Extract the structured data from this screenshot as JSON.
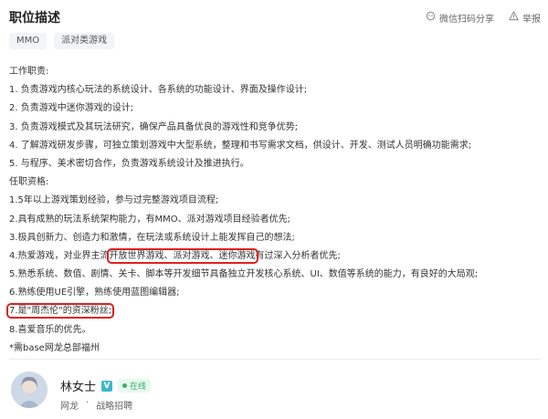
{
  "header": {
    "title": "职位描述",
    "share_label": "微信扫码分享",
    "report_label": "举报"
  },
  "tags": [
    "MMO",
    "派对类游戏"
  ],
  "description": {
    "lines": [
      "工作职责:",
      "1. 负责游戏内核心玩法的系统设计、各系统的功能设计、界面及操作设计;",
      "2. 负责游戏中迷你游戏的设计;",
      "3. 负责游戏模式及其玩法研究，确保产品具备优良的游戏性和竞争优势;",
      "4. 了解游戏研发步骤，可独立策划游戏中大型系统，整理和书写需求文档，供设计、开发、测试人员明确功能需求;",
      "5. 与程序、美术密切合作，负责游戏系统设计及推进执行。",
      "任职资格:",
      "1.5年以上游戏策划经验，参与过完整游戏项目流程;",
      "2.具有成熟的玩法系统架构能力，有MMO、派对游戏项目经验者优先;",
      "3.极具创新力、创造力和激情，在玩法或系统设计上能发挥自己的想法;"
    ],
    "line4_pre": "4.热爱游戏，对业界主流",
    "line4_highlight": "开放世界游戏、派对游戏、迷你游戏",
    "line4_post": "有过深入分析者优先;",
    "lines_b": [
      "5.熟悉系统、数值、剧情、关卡、脚本等开发细节具备独立开发核心系统、UI、数值等系统的能力，有良好的大局观;",
      "6.熟练使用UE引擎，熟练使用蓝图编辑器;"
    ],
    "line7": "7.是\"周杰伦\"的资深粉丝;",
    "lines_c": [
      "8.喜爱音乐的优先。",
      "*需base网龙总部福州"
    ]
  },
  "recruiter": {
    "name": "林女士",
    "verified_icon": "V",
    "status": "在线",
    "company": "网龙",
    "role": "战略招聘"
  },
  "colors": {
    "highlight_border": "#e02020",
    "online_green": "#34b36a",
    "verified": "#3fb6c8"
  }
}
